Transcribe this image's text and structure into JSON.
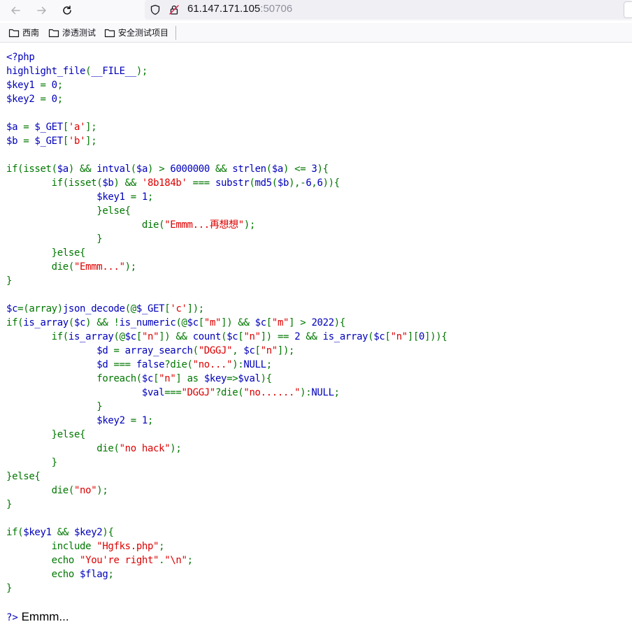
{
  "browser": {
    "url_host": "61.147.171.105",
    "url_port": ":50706",
    "bookmarks": [
      "西南",
      "渗透测试",
      "安全测试项目"
    ]
  },
  "code": {
    "lines": [
      [
        [
          "d",
          "<?php"
        ]
      ],
      [
        [
          "d",
          "highlight_file"
        ],
        [
          "k",
          "("
        ],
        [
          "d",
          "__FILE__"
        ],
        [
          "k",
          ");"
        ]
      ],
      [
        [
          "d",
          "$key1 "
        ],
        [
          "k",
          "= "
        ],
        [
          "d",
          "0"
        ],
        [
          "k",
          ";"
        ]
      ],
      [
        [
          "d",
          "$key2 "
        ],
        [
          "k",
          "= "
        ],
        [
          "d",
          "0"
        ],
        [
          "k",
          ";"
        ]
      ],
      [],
      [
        [
          "d",
          "$a "
        ],
        [
          "k",
          "= "
        ],
        [
          "d",
          "$_GET"
        ],
        [
          "k",
          "["
        ],
        [
          "s",
          "'a'"
        ],
        [
          "k",
          "];"
        ]
      ],
      [
        [
          "d",
          "$b "
        ],
        [
          "k",
          "= "
        ],
        [
          "d",
          "$_GET"
        ],
        [
          "k",
          "["
        ],
        [
          "s",
          "'b'"
        ],
        [
          "k",
          "];"
        ]
      ],
      [],
      [
        [
          "k",
          "if(isset("
        ],
        [
          "d",
          "$a"
        ],
        [
          "k",
          ") && "
        ],
        [
          "d",
          "intval"
        ],
        [
          "k",
          "("
        ],
        [
          "d",
          "$a"
        ],
        [
          "k",
          ") > "
        ],
        [
          "d",
          "6000000 "
        ],
        [
          "k",
          "&& "
        ],
        [
          "d",
          "strlen"
        ],
        [
          "k",
          "("
        ],
        [
          "d",
          "$a"
        ],
        [
          "k",
          ") <= "
        ],
        [
          "d",
          "3"
        ],
        [
          "k",
          "){"
        ]
      ],
      [
        [
          "k",
          "        if(isset("
        ],
        [
          "d",
          "$b"
        ],
        [
          "k",
          ") && "
        ],
        [
          "s",
          "'8b184b' "
        ],
        [
          "k",
          "=== "
        ],
        [
          "d",
          "substr"
        ],
        [
          "k",
          "("
        ],
        [
          "d",
          "md5"
        ],
        [
          "k",
          "("
        ],
        [
          "d",
          "$b"
        ],
        [
          "k",
          "),-"
        ],
        [
          "d",
          "6"
        ],
        [
          "k",
          ","
        ],
        [
          "d",
          "6"
        ],
        [
          "k",
          ")){"
        ]
      ],
      [
        [
          "d",
          "                $key1 "
        ],
        [
          "k",
          "= "
        ],
        [
          "d",
          "1"
        ],
        [
          "k",
          ";"
        ]
      ],
      [
        [
          "k",
          "                }else{"
        ]
      ],
      [
        [
          "k",
          "                        die("
        ],
        [
          "s",
          "\"Emmm...再想想\""
        ],
        [
          "k",
          ");"
        ]
      ],
      [
        [
          "k",
          "                }"
        ]
      ],
      [
        [
          "k",
          "        }else{"
        ]
      ],
      [
        [
          "k",
          "        die("
        ],
        [
          "s",
          "\"Emmm...\""
        ],
        [
          "k",
          ");"
        ]
      ],
      [
        [
          "k",
          "}"
        ]
      ],
      [],
      [
        [
          "d",
          "$c"
        ],
        [
          "k",
          "=(array)"
        ],
        [
          "d",
          "json_decode"
        ],
        [
          "k",
          "(@"
        ],
        [
          "d",
          "$_GET"
        ],
        [
          "k",
          "["
        ],
        [
          "s",
          "'c'"
        ],
        [
          "k",
          "]);"
        ]
      ],
      [
        [
          "k",
          "if("
        ],
        [
          "d",
          "is_array"
        ],
        [
          "k",
          "("
        ],
        [
          "d",
          "$c"
        ],
        [
          "k",
          ") && !"
        ],
        [
          "d",
          "is_numeric"
        ],
        [
          "k",
          "(@"
        ],
        [
          "d",
          "$c"
        ],
        [
          "k",
          "["
        ],
        [
          "s",
          "\"m\""
        ],
        [
          "k",
          "]) && "
        ],
        [
          "d",
          "$c"
        ],
        [
          "k",
          "["
        ],
        [
          "s",
          "\"m\""
        ],
        [
          "k",
          "] > "
        ],
        [
          "d",
          "2022"
        ],
        [
          "k",
          "){"
        ]
      ],
      [
        [
          "k",
          "        if("
        ],
        [
          "d",
          "is_array"
        ],
        [
          "k",
          "(@"
        ],
        [
          "d",
          "$c"
        ],
        [
          "k",
          "["
        ],
        [
          "s",
          "\"n\""
        ],
        [
          "k",
          "]) && "
        ],
        [
          "d",
          "count"
        ],
        [
          "k",
          "("
        ],
        [
          "d",
          "$c"
        ],
        [
          "k",
          "["
        ],
        [
          "s",
          "\"n\""
        ],
        [
          "k",
          "]) == "
        ],
        [
          "d",
          "2 "
        ],
        [
          "k",
          "&& "
        ],
        [
          "d",
          "is_array"
        ],
        [
          "k",
          "("
        ],
        [
          "d",
          "$c"
        ],
        [
          "k",
          "["
        ],
        [
          "s",
          "\"n\""
        ],
        [
          "k",
          "]["
        ],
        [
          "d",
          "0"
        ],
        [
          "k",
          "])){"
        ]
      ],
      [
        [
          "d",
          "                $d "
        ],
        [
          "k",
          "= "
        ],
        [
          "d",
          "array_search"
        ],
        [
          "k",
          "("
        ],
        [
          "s",
          "\"DGGJ\""
        ],
        [
          "k",
          ", "
        ],
        [
          "d",
          "$c"
        ],
        [
          "k",
          "["
        ],
        [
          "s",
          "\"n\""
        ],
        [
          "k",
          "]);"
        ]
      ],
      [
        [
          "d",
          "                $d "
        ],
        [
          "k",
          "=== "
        ],
        [
          "d",
          "false"
        ],
        [
          "k",
          "?die("
        ],
        [
          "s",
          "\"no...\""
        ],
        [
          "k",
          "):"
        ],
        [
          "d",
          "NULL"
        ],
        [
          "k",
          ";"
        ]
      ],
      [
        [
          "k",
          "                foreach("
        ],
        [
          "d",
          "$c"
        ],
        [
          "k",
          "["
        ],
        [
          "s",
          "\"n\""
        ],
        [
          "k",
          "] as "
        ],
        [
          "d",
          "$key"
        ],
        [
          "k",
          "=>"
        ],
        [
          "d",
          "$val"
        ],
        [
          "k",
          "){"
        ]
      ],
      [
        [
          "d",
          "                        $val"
        ],
        [
          "k",
          "==="
        ],
        [
          "s",
          "\"DGGJ\""
        ],
        [
          "k",
          "?die("
        ],
        [
          "s",
          "\"no......\""
        ],
        [
          "k",
          "):"
        ],
        [
          "d",
          "NULL"
        ],
        [
          "k",
          ";"
        ]
      ],
      [
        [
          "k",
          "                }"
        ]
      ],
      [
        [
          "d",
          "                $key2 "
        ],
        [
          "k",
          "= "
        ],
        [
          "d",
          "1"
        ],
        [
          "k",
          ";"
        ]
      ],
      [
        [
          "k",
          "        }else{"
        ]
      ],
      [
        [
          "k",
          "                die("
        ],
        [
          "s",
          "\"no hack\""
        ],
        [
          "k",
          ");"
        ]
      ],
      [
        [
          "k",
          "        }"
        ]
      ],
      [
        [
          "k",
          "}else{"
        ]
      ],
      [
        [
          "k",
          "        die("
        ],
        [
          "s",
          "\"no\""
        ],
        [
          "k",
          ");"
        ]
      ],
      [
        [
          "k",
          "}"
        ]
      ],
      [],
      [
        [
          "k",
          "if("
        ],
        [
          "d",
          "$key1 "
        ],
        [
          "k",
          "&& "
        ],
        [
          "d",
          "$key2"
        ],
        [
          "k",
          "){"
        ]
      ],
      [
        [
          "k",
          "        include "
        ],
        [
          "s",
          "\"Hgfks.php\""
        ],
        [
          "k",
          ";"
        ]
      ],
      [
        [
          "k",
          "        echo "
        ],
        [
          "s",
          "\"You're right\""
        ],
        [
          "k",
          "."
        ],
        [
          "s",
          "\"\\n\""
        ],
        [
          "k",
          ";"
        ]
      ],
      [
        [
          "k",
          "        echo "
        ],
        [
          "d",
          "$flag"
        ],
        [
          "k",
          ";"
        ]
      ],
      [
        [
          "k",
          "}"
        ]
      ],
      [],
      [
        [
          "d",
          "?>"
        ]
      ]
    ]
  },
  "output": {
    "close_tag": "?>",
    "text": " Emmm..."
  },
  "colors": {
    "keyword": "#007700",
    "default": "#0000BB",
    "string": "#DD0000"
  }
}
